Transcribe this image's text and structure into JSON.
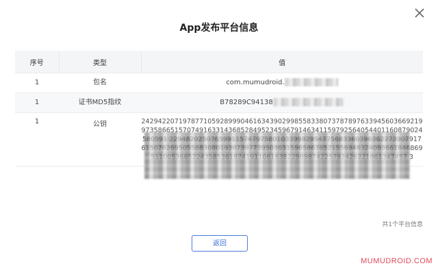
{
  "dialog": {
    "title": "App发布平台信息",
    "close_icon": "close-icon",
    "return_button": "返回",
    "summary": "共1个平台信息"
  },
  "table": {
    "headers": [
      "序号",
      "类型",
      "值"
    ],
    "rows": [
      {
        "index": "1",
        "type": "包名",
        "value": "com.mumudroid."
      },
      {
        "index": "1",
        "type": "证书MD5指纹",
        "value": "B78289C94138"
      },
      {
        "index": "1",
        "type": "公钥",
        "value": "2429422071978771059289990461634390299855833807378789763394560366921997358665157074916331436852849523459679146341159792564054401160879024580591 22948202507659911574797580103399829547756833603963622739079176150762695055883080193073977395036315965867652155694632409366184686951100536652243585361874191106163822989874225792426221861347457 3"
      }
    ]
  },
  "watermark": "MUMUDROID.COM",
  "colors": {
    "accent": "#3a6fd8",
    "watermark": "#e2495b",
    "header_bg": "#f4f5f7"
  }
}
